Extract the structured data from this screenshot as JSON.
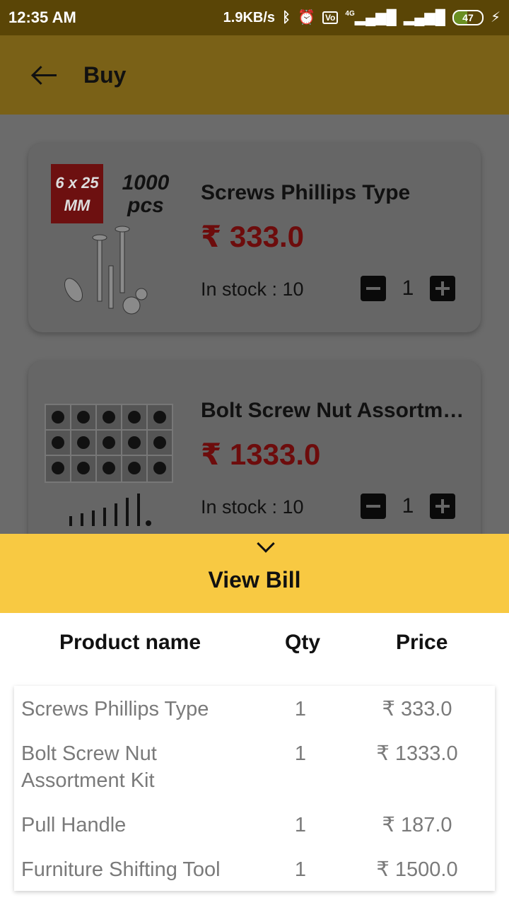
{
  "statusbar": {
    "time": "12:35 AM",
    "speed": "1.9KB/s",
    "network": "4G",
    "battery": "47"
  },
  "appbar": {
    "title": "Buy"
  },
  "products": [
    {
      "name": "Screws Phillips Type",
      "price": "₹ 333.0",
      "stock": "In stock : 10",
      "qty": "1",
      "image_text_1": "6 x 25 MM",
      "image_text_2": "1000 pcs"
    },
    {
      "name": "Bolt Screw Nut Assortment Kit",
      "price": "₹ 1333.0",
      "stock": "In stock : 10",
      "qty": "1"
    }
  ],
  "bill": {
    "toggle_label": "View Bill",
    "headers": {
      "name": "Product name",
      "qty": "Qty",
      "price": "Price"
    },
    "rows": [
      {
        "name": "Screws Phillips Type",
        "qty": "1",
        "price": "₹ 333.0"
      },
      {
        "name": "Bolt Screw Nut Assortment Kit",
        "qty": "1",
        "price": "₹ 1333.0"
      },
      {
        "name": "Pull Handle",
        "qty": "1",
        "price": "₹ 187.0"
      },
      {
        "name": "Furniture Shifting Tool",
        "qty": "1",
        "price": "₹ 1500.0"
      }
    ]
  },
  "colors": {
    "appbar": "#7a6117",
    "statusbar": "#5a4506",
    "sheet_header": "#f8c942",
    "price": "#6d0c0c"
  }
}
